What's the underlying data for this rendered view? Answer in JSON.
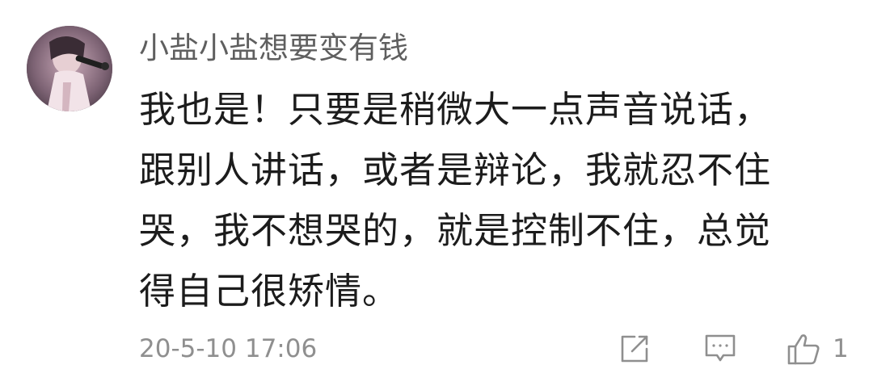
{
  "comment": {
    "username": "小盐小盐想要变有钱",
    "text_lines": [
      "我也是！只要是稍微大一点声音说话，",
      "跟别人讲话，或者是辩论，我就忍不住",
      "哭，我不想哭的，就是控制不住，总觉",
      "得自己很矫情。"
    ],
    "timestamp": "20-5-10 17:06",
    "likes": "1"
  },
  "icons": {
    "share": "share-external-icon",
    "reply": "comment-bubble-icon",
    "like": "thumbs-up-icon"
  },
  "colors": {
    "username": "#5f5f5f",
    "body": "#1c1c1c",
    "meta": "#8f8f8f"
  }
}
